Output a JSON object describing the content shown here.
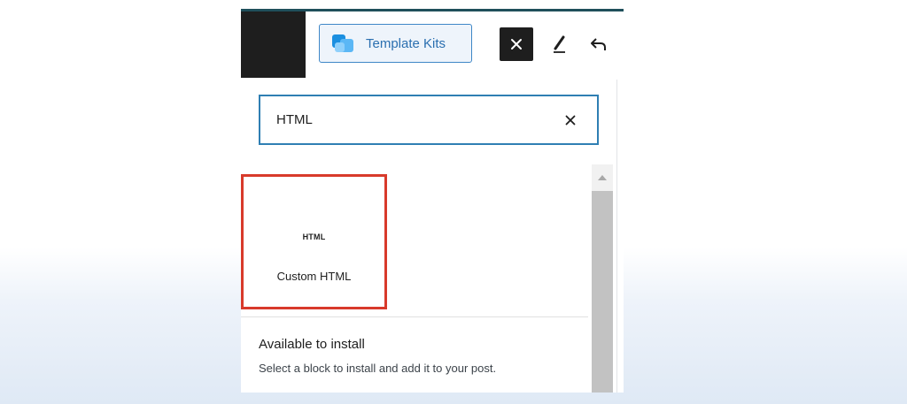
{
  "toolbar": {
    "template_kits_label": "Template Kits",
    "close_icon": "close-icon",
    "edit_icon": "pencil-icon",
    "undo_icon": "undo-icon",
    "template_kits_icon": "template-kits-icon"
  },
  "search": {
    "value": "HTML",
    "clear_icon": "close-icon"
  },
  "results": {
    "items": [
      {
        "icon_text": "HTML",
        "label": "Custom HTML"
      }
    ]
  },
  "install": {
    "title": "Available to install",
    "description": "Select a block to install and add it to your post."
  },
  "colors": {
    "accent": "#2f7fb3",
    "highlight_border": "#d83a2b",
    "kits_text": "#2a6fb0",
    "dark": "#1e1e1e"
  }
}
